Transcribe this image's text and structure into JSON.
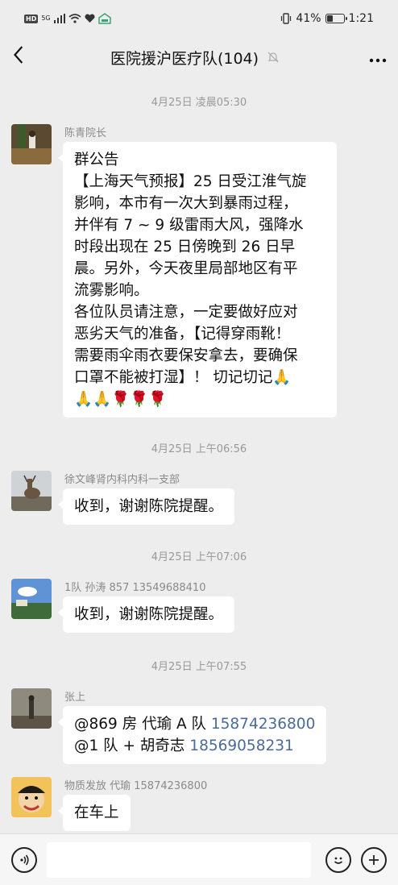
{
  "status_bar": {
    "hd": "HD",
    "network": "5G",
    "battery": "41%",
    "battery_level": 0.41,
    "time": "1:21"
  },
  "nav": {
    "title": "医院援沪医疗队(104)",
    "back_icon": "chevron-left-icon",
    "mute_icon": "bell-mute-icon",
    "more_icon": "more-dots-icon"
  },
  "messages": {
    "ts1": "4月25日 凌晨05:30",
    "m1": {
      "sender": "陈青院长",
      "lines": [
        "群公告",
        "【上海天气预报】25 日受江淮气旋",
        "影响，本市有一次大到暴雨过程，",
        "并伴有 7 ~ 9 级雷雨大风，强降水",
        "时段出现在 25 日傍晚到 26 日早",
        "晨。另外，今天夜里局部地区有平",
        "流雾影响。",
        "各位队员请注意，一定要做好应对",
        "恶劣天气的准备，【记得穿雨靴！",
        "需要雨伞雨衣要保安拿去，要确保",
        "口罩不能被打湿】！ 切记切记🙏",
        "🙏🙏🌹🌹🌹"
      ]
    },
    "ts2": "4月25日 上午06:56",
    "m2": {
      "sender": "徐文峰肾内科内科一支部",
      "text": "收到，谢谢陈院提醒。"
    },
    "ts3": "4月25日 上午07:06",
    "m3": {
      "sender": "1队 孙涛 857  13549688410",
      "text": "收到，谢谢陈院提醒。"
    },
    "ts4": "4月25日 上午07:55",
    "m4": {
      "sender": "张上",
      "line1_prefix": "@869 房 代瑜  A 队 ",
      "line1_phone": "15874236800",
      "line2_prefix": "@1 队 + 胡奇志 ",
      "line2_phone": "18569058231"
    },
    "m5": {
      "sender": "物质发放 代瑜 15874236800",
      "text": "在车上"
    }
  },
  "input_bar": {
    "voice_icon": "voice-icon",
    "emoji_icon": "emoji-smile-icon",
    "plus_icon": "plus-icon"
  },
  "colors": {
    "background": "#ededed",
    "bubble": "#ffffff",
    "link": "#4a6b9a",
    "meta_text": "#999999"
  }
}
